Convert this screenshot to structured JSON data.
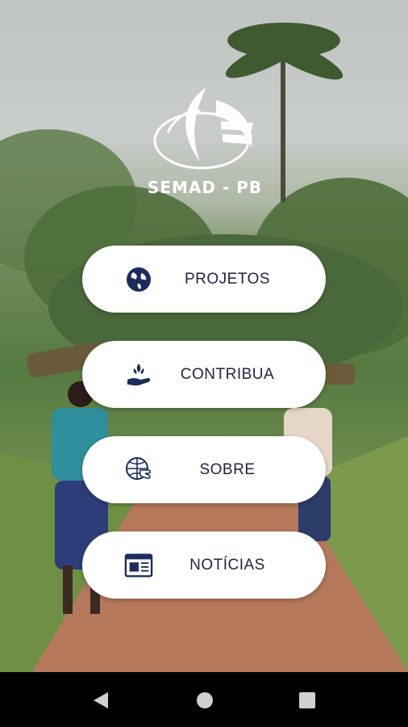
{
  "logo": {
    "text": "SEMAD - PB",
    "icon": "semad-logo"
  },
  "menu": [
    {
      "label": "PROJETOS",
      "icon": "globe-icon"
    },
    {
      "label": "CONTRIBUA",
      "icon": "hand-plant-icon"
    },
    {
      "label": "SOBRE",
      "icon": "globe-hand-icon"
    },
    {
      "label": "NOTÍCIAS",
      "icon": "newspaper-icon"
    }
  ],
  "nav": {
    "back": "back-icon",
    "home": "home-icon",
    "recent": "recent-apps-icon"
  },
  "colors": {
    "icon": "#1c2c5c",
    "label": "#1f2340",
    "button": "#ffffff"
  }
}
